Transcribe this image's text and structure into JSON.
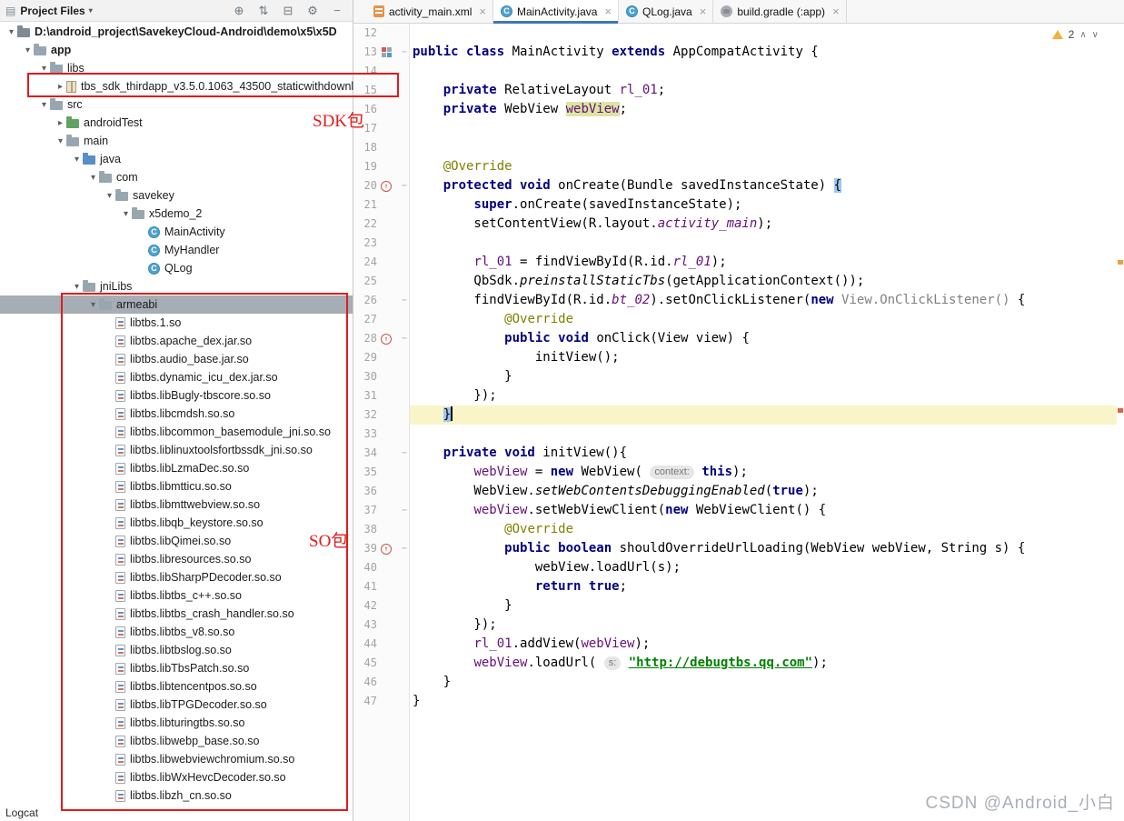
{
  "icons": {
    "panel": "▤",
    "dropdown": "▾",
    "locate": "⊕",
    "sort": "⇅",
    "collapse": "⊟",
    "gear": "⚙",
    "minus": "−",
    "close": "×",
    "chevron_open": "▾",
    "chevron_closed": "▸",
    "fold": "−",
    "override_arrow": "↑",
    "class_letter": "C",
    "nav_up": "∧",
    "nav_down": "∨"
  },
  "project_panel": {
    "header": {
      "title": "Project Files"
    },
    "tree": [
      {
        "label": "D:\\android_project\\SavekeyCloud-Android\\demo\\x5\\x5D",
        "depth": 0,
        "icon": "module",
        "chevron": "open",
        "bold": true
      },
      {
        "label": "app",
        "depth": 1,
        "icon": "folder",
        "chevron": "open",
        "bold": true
      },
      {
        "label": "libs",
        "depth": 2,
        "icon": "folder",
        "chevron": "open"
      },
      {
        "label": "tbs_sdk_thirdapp_v3.5.0.1063_43500_staticwithdownl",
        "depth": 3,
        "icon": "archive",
        "chevron": "closed",
        "overflow": true
      },
      {
        "label": "src",
        "depth": 2,
        "icon": "folder",
        "chevron": "open"
      },
      {
        "label": "androidTest",
        "depth": 3,
        "icon": "folder-test",
        "chevron": "closed"
      },
      {
        "label": "main",
        "depth": 3,
        "icon": "folder",
        "chevron": "open"
      },
      {
        "label": "java",
        "depth": 4,
        "icon": "folder-src",
        "chevron": "open"
      },
      {
        "label": "com",
        "depth": 5,
        "icon": "folder",
        "chevron": "open"
      },
      {
        "label": "savekey",
        "depth": 6,
        "icon": "folder",
        "chevron": "open"
      },
      {
        "label": "x5demo_2",
        "depth": 7,
        "icon": "folder",
        "chevron": "open"
      },
      {
        "label": "MainActivity",
        "depth": 8,
        "icon": "class"
      },
      {
        "label": "MyHandler",
        "depth": 8,
        "icon": "class"
      },
      {
        "label": "QLog",
        "depth": 8,
        "icon": "class"
      },
      {
        "label": "jniLibs",
        "depth": 4,
        "icon": "folder",
        "chevron": "open"
      },
      {
        "label": "armeabi",
        "depth": 5,
        "icon": "folder",
        "chevron": "open",
        "selected": true
      },
      {
        "label": "libtbs.1.so",
        "depth": 6,
        "icon": "so"
      },
      {
        "label": "libtbs.apache_dex.jar.so",
        "depth": 6,
        "icon": "so"
      },
      {
        "label": "libtbs.audio_base.jar.so",
        "depth": 6,
        "icon": "so"
      },
      {
        "label": "libtbs.dynamic_icu_dex.jar.so",
        "depth": 6,
        "icon": "so"
      },
      {
        "label": "libtbs.libBugly-tbscore.so.so",
        "depth": 6,
        "icon": "so"
      },
      {
        "label": "libtbs.libcmdsh.so.so",
        "depth": 6,
        "icon": "so"
      },
      {
        "label": "libtbs.libcommon_basemodule_jni.so.so",
        "depth": 6,
        "icon": "so"
      },
      {
        "label": "libtbs.liblinuxtoolsfortbssdk_jni.so.so",
        "depth": 6,
        "icon": "so"
      },
      {
        "label": "libtbs.libLzmaDec.so.so",
        "depth": 6,
        "icon": "so"
      },
      {
        "label": "libtbs.libmtticu.so.so",
        "depth": 6,
        "icon": "so"
      },
      {
        "label": "libtbs.libmttwebview.so.so",
        "depth": 6,
        "icon": "so"
      },
      {
        "label": "libtbs.libqb_keystore.so.so",
        "depth": 6,
        "icon": "so"
      },
      {
        "label": "libtbs.libQimei.so.so",
        "depth": 6,
        "icon": "so"
      },
      {
        "label": "libtbs.libresources.so.so",
        "depth": 6,
        "icon": "so"
      },
      {
        "label": "libtbs.libSharpPDecoder.so.so",
        "depth": 6,
        "icon": "so"
      },
      {
        "label": "libtbs.libtbs_c++.so.so",
        "depth": 6,
        "icon": "so"
      },
      {
        "label": "libtbs.libtbs_crash_handler.so.so",
        "depth": 6,
        "icon": "so"
      },
      {
        "label": "libtbs.libtbs_v8.so.so",
        "depth": 6,
        "icon": "so"
      },
      {
        "label": "libtbs.libtbslog.so.so",
        "depth": 6,
        "icon": "so"
      },
      {
        "label": "libtbs.libTbsPatch.so.so",
        "depth": 6,
        "icon": "so"
      },
      {
        "label": "libtbs.libtencentpos.so.so",
        "depth": 6,
        "icon": "so"
      },
      {
        "label": "libtbs.libTPGDecoder.so.so",
        "depth": 6,
        "icon": "so"
      },
      {
        "label": "libtbs.libturingtbs.so.so",
        "depth": 6,
        "icon": "so"
      },
      {
        "label": "libtbs.libwebp_base.so.so",
        "depth": 6,
        "icon": "so"
      },
      {
        "label": "libtbs.libwebviewchromium.so.so",
        "depth": 6,
        "icon": "so"
      },
      {
        "label": "libtbs.libWxHevcDecoder.so.so",
        "depth": 6,
        "icon": "so"
      },
      {
        "label": "libtbs.libzh_cn.so.so",
        "depth": 6,
        "icon": "so"
      }
    ],
    "bottom_label": "Logcat"
  },
  "editor": {
    "tabs": [
      {
        "label": "activity_main.xml",
        "icon": "xml",
        "active": false
      },
      {
        "label": "MainActivity.java",
        "icon": "class",
        "active": true
      },
      {
        "label": "QLog.java",
        "icon": "class",
        "active": false
      },
      {
        "label": "build.gradle (:app)",
        "icon": "gradle",
        "active": false
      }
    ],
    "inspection": {
      "count": "2"
    },
    "code": {
      "lines": [
        {
          "n": 12,
          "seg": []
        },
        {
          "n": 13,
          "gicon": "class",
          "fold": true,
          "seg": [
            [
              "k",
              "public class "
            ],
            [
              "p",
              "MainActivity "
            ],
            [
              "k",
              "extends "
            ],
            [
              "p",
              "AppCompatActivity {"
            ]
          ]
        },
        {
          "n": 14,
          "seg": []
        },
        {
          "n": 15,
          "seg": [
            [
              "p",
              "    "
            ],
            [
              "k",
              "private "
            ],
            [
              "p",
              "RelativeLayout "
            ],
            [
              "f",
              "rl_01"
            ],
            [
              "p",
              ";"
            ]
          ]
        },
        {
          "n": 16,
          "seg": [
            [
              "p",
              "    "
            ],
            [
              "k",
              "private "
            ],
            [
              "p",
              "WebView "
            ],
            [
              "fhl",
              "webView"
            ],
            [
              "p",
              ";"
            ]
          ]
        },
        {
          "n": 17,
          "seg": []
        },
        {
          "n": 18,
          "seg": []
        },
        {
          "n": 19,
          "seg": [
            [
              "p",
              "    "
            ],
            [
              "ann",
              "@Override"
            ]
          ]
        },
        {
          "n": 20,
          "gicon": "override",
          "fold": true,
          "seg": [
            [
              "p",
              "    "
            ],
            [
              "k",
              "protected void "
            ],
            [
              "p",
              "onCreate(Bundle savedInstanceState) "
            ],
            [
              "bhl",
              "{"
            ]
          ]
        },
        {
          "n": 21,
          "seg": [
            [
              "p",
              "        "
            ],
            [
              "k",
              "super"
            ],
            [
              "p",
              ".onCreate(savedInstanceState);"
            ]
          ]
        },
        {
          "n": 22,
          "seg": [
            [
              "p",
              "        setContentView(R.layout."
            ],
            [
              "sf",
              "activity_main"
            ],
            [
              "p",
              ");"
            ]
          ]
        },
        {
          "n": 23,
          "seg": []
        },
        {
          "n": 24,
          "seg": [
            [
              "p",
              "        "
            ],
            [
              "f",
              "rl_01"
            ],
            [
              "p",
              " = findViewById(R.id."
            ],
            [
              "sf",
              "rl_01"
            ],
            [
              "p",
              ");"
            ]
          ]
        },
        {
          "n": 25,
          "seg": [
            [
              "p",
              "        QbSdk."
            ],
            [
              "smi",
              "preinstallStaticTbs"
            ],
            [
              "p",
              "(getApplicationContext());"
            ]
          ]
        },
        {
          "n": 26,
          "fold": true,
          "seg": [
            [
              "p",
              "        findViewById(R.id."
            ],
            [
              "sf",
              "bt_02"
            ],
            [
              "p",
              ").setOnClickListener("
            ],
            [
              "k",
              "new "
            ],
            [
              "g",
              "View.OnClickListener() "
            ],
            [
              "p",
              "{"
            ]
          ]
        },
        {
          "n": 27,
          "seg": [
            [
              "p",
              "            "
            ],
            [
              "ann",
              "@Override"
            ]
          ]
        },
        {
          "n": 28,
          "gicon": "override",
          "fold": true,
          "seg": [
            [
              "p",
              "            "
            ],
            [
              "k",
              "public void "
            ],
            [
              "p",
              "onClick(View view) {"
            ]
          ]
        },
        {
          "n": 29,
          "seg": [
            [
              "p",
              "                initView();"
            ]
          ]
        },
        {
          "n": 30,
          "seg": [
            [
              "p",
              "            }"
            ]
          ]
        },
        {
          "n": 31,
          "seg": [
            [
              "p",
              "        });"
            ]
          ]
        },
        {
          "n": 32,
          "current": true,
          "caret": true,
          "seg": [
            [
              "p",
              "    "
            ],
            [
              "bhl",
              "}"
            ]
          ]
        },
        {
          "n": 33,
          "seg": []
        },
        {
          "n": 34,
          "fold": true,
          "seg": [
            [
              "p",
              "    "
            ],
            [
              "k",
              "private void "
            ],
            [
              "p",
              "initView(){"
            ]
          ]
        },
        {
          "n": 35,
          "seg": [
            [
              "p",
              "        "
            ],
            [
              "f",
              "webView"
            ],
            [
              "p",
              " = "
            ],
            [
              "k",
              "new "
            ],
            [
              "p",
              "WebView( "
            ],
            [
              "hint",
              "context:"
            ],
            [
              "p",
              " "
            ],
            [
              "k",
              "this"
            ],
            [
              "p",
              ");"
            ]
          ]
        },
        {
          "n": 36,
          "seg": [
            [
              "p",
              "        WebView."
            ],
            [
              "smi",
              "setWebContentsDebuggingEnabled"
            ],
            [
              "p",
              "("
            ],
            [
              "k",
              "true"
            ],
            [
              "p",
              ");"
            ]
          ]
        },
        {
          "n": 37,
          "fold": true,
          "seg": [
            [
              "p",
              "        "
            ],
            [
              "f",
              "webView"
            ],
            [
              "p",
              ".setWebViewClient("
            ],
            [
              "k",
              "new "
            ],
            [
              "p",
              "WebViewClient() {"
            ]
          ]
        },
        {
          "n": 38,
          "seg": [
            [
              "p",
              "            "
            ],
            [
              "ann",
              "@Override"
            ]
          ]
        },
        {
          "n": 39,
          "gicon": "override",
          "fold": true,
          "seg": [
            [
              "p",
              "            "
            ],
            [
              "k",
              "public boolean "
            ],
            [
              "p",
              "shouldOverrideUrlLoading(WebView webView, String s) {"
            ]
          ]
        },
        {
          "n": 40,
          "seg": [
            [
              "p",
              "                webView.loadUrl(s);"
            ]
          ]
        },
        {
          "n": 41,
          "seg": [
            [
              "p",
              "                "
            ],
            [
              "k",
              "return true"
            ],
            [
              "p",
              ";"
            ]
          ]
        },
        {
          "n": 42,
          "seg": [
            [
              "p",
              "            }"
            ]
          ]
        },
        {
          "n": 43,
          "seg": [
            [
              "p",
              "        });"
            ]
          ]
        },
        {
          "n": 44,
          "seg": [
            [
              "p",
              "        "
            ],
            [
              "f",
              "rl_01"
            ],
            [
              "p",
              ".addView("
            ],
            [
              "f",
              "webView"
            ],
            [
              "p",
              ");"
            ]
          ]
        },
        {
          "n": 45,
          "seg": [
            [
              "p",
              "        "
            ],
            [
              "f",
              "webView"
            ],
            [
              "p",
              ".loadUrl( "
            ],
            [
              "hint",
              "s:"
            ],
            [
              "p",
              " "
            ],
            [
              "str",
              "\"http://debugtbs.qq.com\""
            ],
            [
              "p",
              ");"
            ]
          ]
        },
        {
          "n": 46,
          "seg": [
            [
              "p",
              "    }"
            ]
          ]
        },
        {
          "n": 47,
          "seg": [
            [
              "p",
              "}"
            ]
          ]
        }
      ]
    }
  },
  "annotations": {
    "sdk_box_label": "SDK包",
    "so_box_label": "SO包"
  },
  "watermark": "CSDN @Android_小白",
  "colors": {
    "accent": "#3C77BE",
    "annotation_red": "#E21B1B",
    "selection_gray": "#A6ADB4",
    "current_line": "#FAF5C8",
    "keyword": "#000080",
    "field_purple": "#660E7A",
    "string_green": "#008000",
    "annotation_olive": "#808000"
  }
}
